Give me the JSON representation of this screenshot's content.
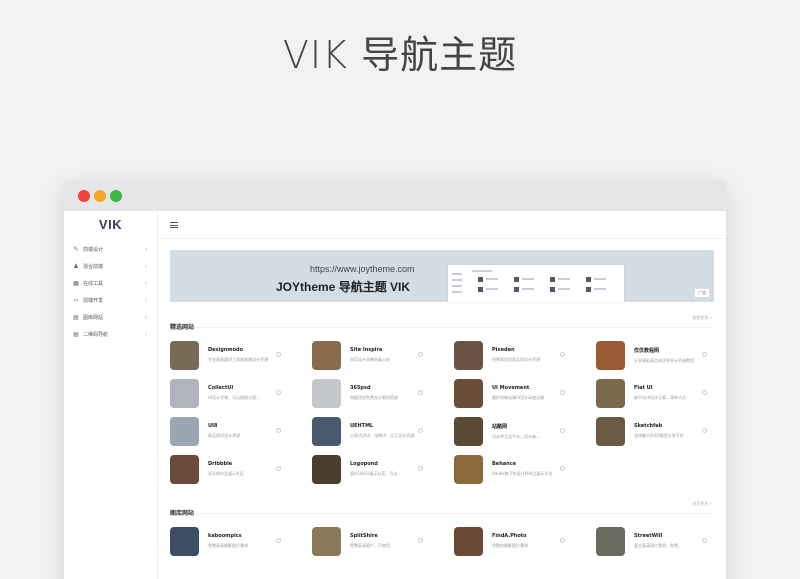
{
  "hero": {
    "title": "VIK 导航主题"
  },
  "window": {
    "logo": "VIK",
    "sidebar": {
      "items": [
        {
          "icon": "pen-icon",
          "glyph": "✎",
          "label": "前端设计"
        },
        {
          "icon": "bell-icon",
          "glyph": "♟",
          "label": "混合前端"
        },
        {
          "icon": "grid-icon",
          "glyph": "▦",
          "label": "在线工具"
        },
        {
          "icon": "code-icon",
          "glyph": "‹›",
          "label": "前端开发"
        },
        {
          "icon": "doc-icon",
          "glyph": "▤",
          "label": "图库网站"
        },
        {
          "icon": "doc-icon",
          "glyph": "▤",
          "label": "二维码导航"
        }
      ]
    },
    "banner": {
      "url": "https://www.joytheme.com",
      "title": "JOYtheme 导航主题 VIK",
      "badge": "广告"
    },
    "sections": [
      {
        "title": "精选网站",
        "more": "查看更多 »",
        "cards": [
          {
            "name": "Designmodo",
            "desc": "专业高质量UI工具和前端设计资源",
            "color": "#7a6a58"
          },
          {
            "name": "Site Inspire",
            "desc": "网页设计灵感的展示站",
            "color": "#8a6b4e"
          },
          {
            "name": "Pixeden",
            "desc": "免费和优质高品质设计资源",
            "color": "#6a5446"
          },
          {
            "name": "优优教程网",
            "desc": "分享精彩高品质优秀设计资源教程",
            "color": "#9a5a34"
          },
          {
            "name": "CollectUI",
            "desc": "UI设计灵感，可以按照分类...",
            "color": "#b0b5bb"
          },
          {
            "name": "365psd",
            "desc": "海量优质免费设计素材资源",
            "color": "#c4c8cc"
          },
          {
            "name": "UI Movement",
            "desc": "最好的移动端UI设计动效灵感",
            "color": "#6a4e3a"
          },
          {
            "name": "Flat UI",
            "desc": "扁平化UI设计元素，简单大方...",
            "color": "#7b6a4a"
          },
          {
            "name": "UI8",
            "desc": "高品质UI设计资源",
            "color": "#9aa6b4"
          },
          {
            "name": "UEHTML",
            "desc": "分享优质UI、电商UI、交互设计资源...",
            "color": "#4a5a6e"
          },
          {
            "name": "站酷网",
            "desc": "设计师互动平台，设计者...",
            "color": "#5a4a34"
          },
          {
            "name": "Sketchfab",
            "desc": "全球最大的3D模型分享平台",
            "color": "#6a5a44"
          },
          {
            "name": "Dribbble",
            "desc": "设计师作品展示社区",
            "color": "#6a4a3a"
          },
          {
            "name": "Logopond",
            "desc": "国外LOGO展示社区，可以...",
            "color": "#4a3e2c"
          },
          {
            "name": "Behance",
            "desc": "Adobe旗下的设计师作品展示平台",
            "color": "#8a6a3a"
          }
        ]
      },
      {
        "title": "图库网站",
        "more": "查看更多 »",
        "cards": [
          {
            "name": "kaboompics",
            "desc": "免费高清摄影图片素材",
            "color": "#3e4e62"
          },
          {
            "name": "SplitShire",
            "desc": "免费高清图片，可商用...",
            "color": "#8a7a5a"
          },
          {
            "name": "FindA.Photo",
            "desc": "免费的摄影图片素材",
            "color": "#6a4a34"
          },
          {
            "name": "StreetWill",
            "desc": "复古高清图片素材，免费...",
            "color": "#6a6a5e"
          }
        ]
      }
    ]
  }
}
